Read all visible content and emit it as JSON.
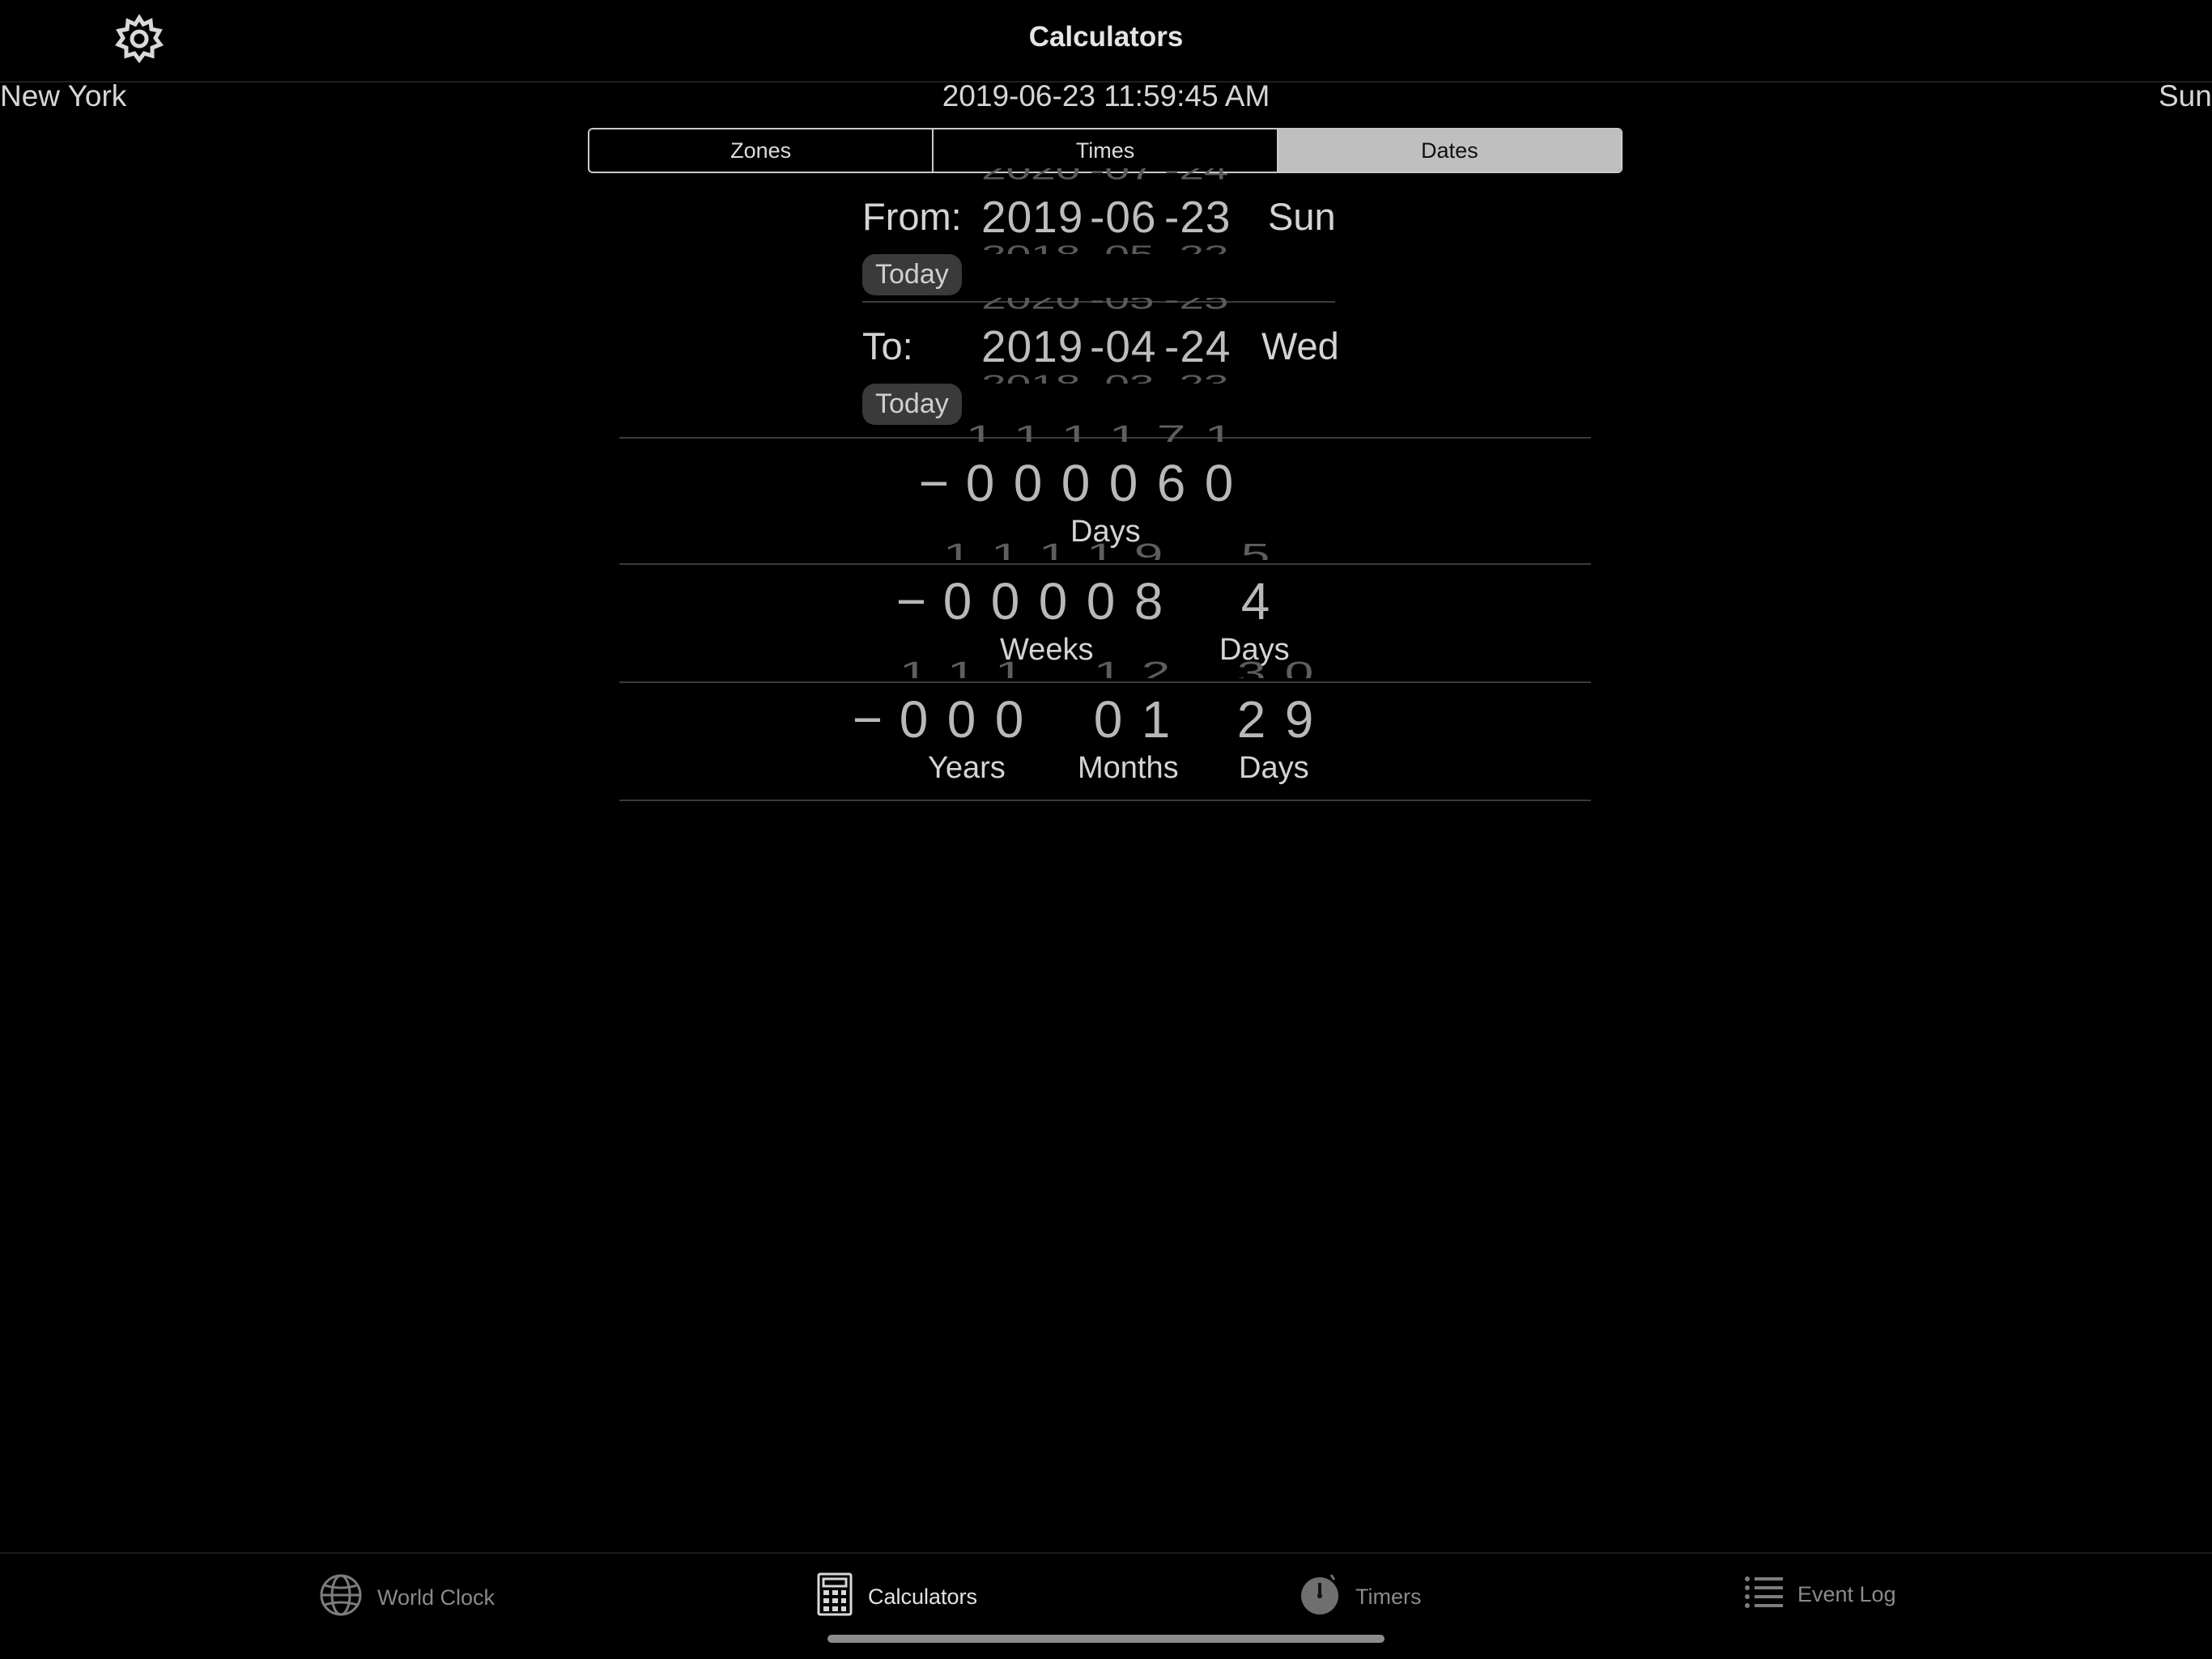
{
  "header": {
    "title": "Calculators",
    "settings_icon": "gear-icon"
  },
  "status": {
    "city": "New York",
    "datetime": "2019-06-23 11:59:45 AM",
    "weekday": "Sun"
  },
  "segments": {
    "items": [
      {
        "label": "Zones",
        "selected": false
      },
      {
        "label": "Times",
        "selected": false
      },
      {
        "label": "Dates",
        "selected": true
      }
    ]
  },
  "from": {
    "label": "From:",
    "year": "2019",
    "month": "-06",
    "day": "-23",
    "year_above": "2020",
    "month_above": "-07",
    "day_above": "-24",
    "year_below": "2018",
    "month_below": "-05",
    "day_below": "-22",
    "weekday": "Sun",
    "today_button": "Today"
  },
  "to": {
    "label": "To:",
    "year": "2019",
    "month": "-04",
    "day": "-24",
    "year_above": "2020",
    "month_above": "-05",
    "day_above": "-25",
    "year_below": "2018",
    "month_below": "-03",
    "day_below": "-23",
    "weekday": "Wed",
    "today_button": "Today"
  },
  "results": {
    "days": {
      "sign": "−",
      "digits": [
        "0",
        "0",
        "0",
        "0",
        "6",
        "0"
      ],
      "label": "Days"
    },
    "weeks_days": {
      "sign": "−",
      "weeks_digits": [
        "0",
        "0",
        "0",
        "0",
        "8"
      ],
      "weeks_label": "Weeks",
      "days_digit": "4",
      "days_label": "Days"
    },
    "ymd": {
      "sign": "−",
      "years_digits": [
        "0",
        "0",
        "0"
      ],
      "years_label": "Years",
      "months_digits": [
        "0",
        "1"
      ],
      "months_label": "Months",
      "days_digits": [
        "2",
        "9"
      ],
      "days_label": "Days"
    }
  },
  "tabbar": {
    "items": [
      {
        "label": "World Clock",
        "icon": "globe-icon",
        "active": false
      },
      {
        "label": "Calculators",
        "icon": "calculator-icon",
        "active": true
      },
      {
        "label": "Timers",
        "icon": "stopwatch-icon",
        "active": false
      },
      {
        "label": "Event Log",
        "icon": "list-icon",
        "active": false
      }
    ]
  }
}
